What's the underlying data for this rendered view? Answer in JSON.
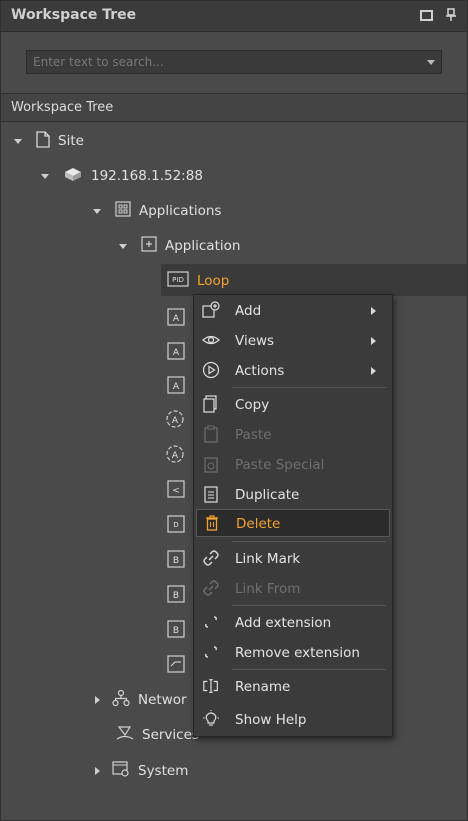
{
  "panel": {
    "title": "Workspace Tree",
    "maximize_icon": "maximize-icon",
    "pin_icon": "pin-icon"
  },
  "search": {
    "placeholder": "Enter text to search...",
    "value": ""
  },
  "section": {
    "label": "Workspace Tree"
  },
  "tree": {
    "site": "Site",
    "station": "192.168.1.52:88",
    "applications": "Applications",
    "application": "Application",
    "loop": "Loop",
    "networks": "Networ",
    "services": "Services",
    "system": "System"
  },
  "context_menu": {
    "items": [
      {
        "label": "Add",
        "icon": "add-icon",
        "submenu": true,
        "enabled": true
      },
      {
        "label": "Views",
        "icon": "eye-icon",
        "submenu": true,
        "enabled": true
      },
      {
        "label": "Actions",
        "icon": "play-circle-icon",
        "submenu": true,
        "enabled": true
      },
      {
        "label": "Copy",
        "icon": "copy-icon",
        "enabled": true
      },
      {
        "label": "Paste",
        "icon": "paste-icon",
        "enabled": false
      },
      {
        "label": "Paste Special",
        "icon": "paste-special-icon",
        "enabled": false
      },
      {
        "label": "Duplicate",
        "icon": "duplicate-icon",
        "enabled": true
      },
      {
        "label": "Delete",
        "icon": "trash-icon",
        "enabled": true,
        "highlighted": true
      },
      {
        "label": "Link Mark",
        "icon": "link-icon",
        "enabled": true
      },
      {
        "label": "Link From",
        "icon": "link-from-icon",
        "enabled": false
      },
      {
        "label": "Add extension",
        "icon": "extension-add-icon",
        "enabled": true
      },
      {
        "label": "Remove extension",
        "icon": "extension-remove-icon",
        "enabled": true
      },
      {
        "label": "Rename",
        "icon": "rename-icon",
        "enabled": true
      },
      {
        "label": "Show Help",
        "icon": "lightbulb-icon",
        "enabled": true
      }
    ]
  },
  "colors": {
    "accent": "#f4a12c",
    "background": "#4a4a4a",
    "menu_bg": "#3b3b3b",
    "disabled": "#6f6f6f"
  }
}
